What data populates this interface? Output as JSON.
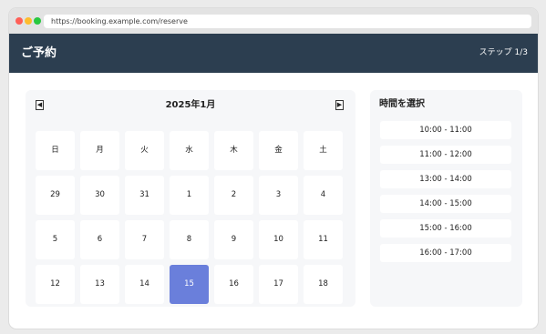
{
  "browser": {
    "url": "https://booking.example.com/reserve"
  },
  "header": {
    "title": "ご予約",
    "step": "ステップ 1/3"
  },
  "calendar": {
    "title": "2025年1月",
    "prev_icon": "◀",
    "next_icon": "▶",
    "weekdays": [
      "日",
      "月",
      "火",
      "水",
      "木",
      "金",
      "土"
    ],
    "weeks": [
      [
        "29",
        "30",
        "31",
        "1",
        "2",
        "3",
        "4"
      ],
      [
        "5",
        "6",
        "7",
        "8",
        "9",
        "10",
        "11"
      ],
      [
        "12",
        "13",
        "14",
        "15",
        "16",
        "17",
        "18"
      ]
    ],
    "selected_day": "15",
    "selected_color": "#6a7fdb"
  },
  "time_panel": {
    "heading": "時間を選択",
    "slots": [
      "10:00 - 11:00",
      "11:00 - 12:00",
      "13:00 - 14:00",
      "14:00 - 15:00",
      "15:00 - 16:00",
      "16:00 - 17:00"
    ]
  },
  "colors": {
    "header_bg": "#2c3e50",
    "accent": "#6a7fdb"
  }
}
